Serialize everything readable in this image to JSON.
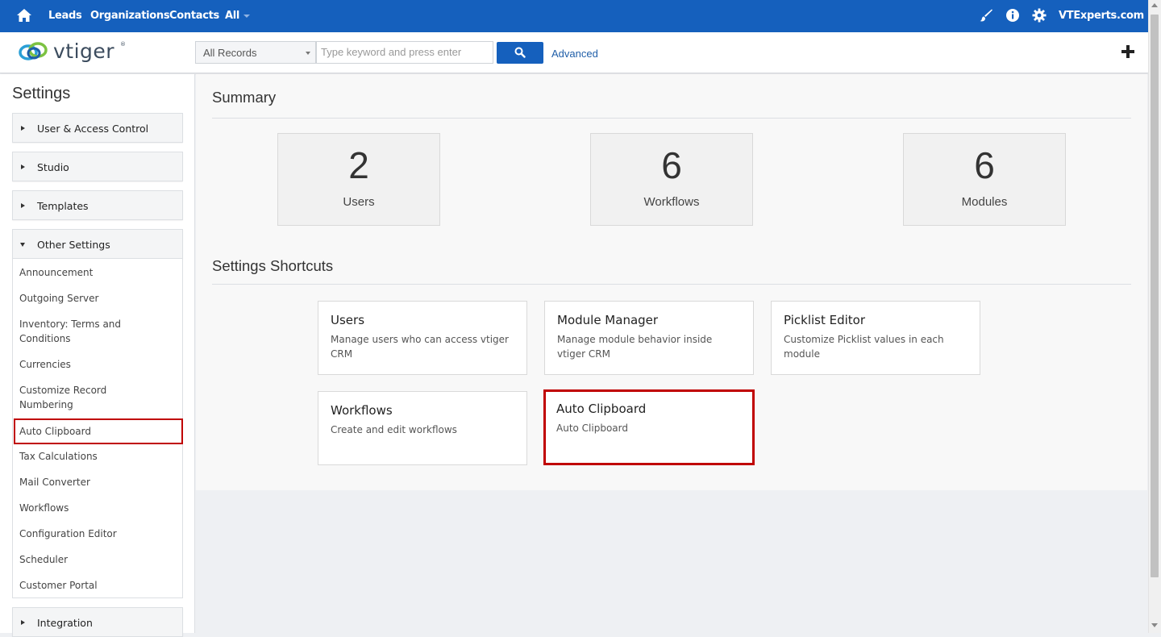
{
  "topnav": {
    "items": [
      "Leads",
      "Organizations",
      "Contacts",
      "All"
    ],
    "account": "VTExperts.com",
    "icons": [
      "home-icon",
      "paint-brush-icon",
      "info-icon",
      "gear-icon"
    ],
    "bg_color": "#1560bd"
  },
  "header": {
    "logo_text": "vtiger",
    "logo_mark": "®",
    "records_select": "All Records",
    "search_placeholder": "Type keyword and press enter",
    "advanced_label": "Advanced"
  },
  "sidebar": {
    "title": "Settings",
    "groups": [
      "User & Access Control",
      "Studio",
      "Templates",
      "Other Settings",
      "Integration"
    ],
    "other_items": [
      "Announcement",
      "Outgoing Server",
      "Inventory: Terms and Conditions",
      "Currencies",
      "Customize Record Numbering",
      "Auto Clipboard",
      "Tax Calculations",
      "Mail Converter",
      "Workflows",
      "Configuration Editor",
      "Scheduler",
      "Customer Portal"
    ],
    "active_item": "Auto Clipboard"
  },
  "summary": {
    "title": "Summary",
    "stats": [
      {
        "value": "2",
        "label": "Users"
      },
      {
        "value": "6",
        "label": "Workflows"
      },
      {
        "value": "6",
        "label": "Modules"
      }
    ]
  },
  "shortcuts": {
    "title": "Settings Shortcuts",
    "cards": [
      {
        "title": "Users",
        "desc": "Manage users who can access vtiger CRM"
      },
      {
        "title": "Module Manager",
        "desc": "Manage module behavior inside vtiger CRM"
      },
      {
        "title": "Picklist Editor",
        "desc": "Customize Picklist values in each module"
      },
      {
        "title": "Workflows",
        "desc": "Create and edit workflows"
      },
      {
        "title": "Auto Clipboard",
        "desc": "Auto Clipboard"
      }
    ],
    "highlight_color": "#c00000"
  }
}
